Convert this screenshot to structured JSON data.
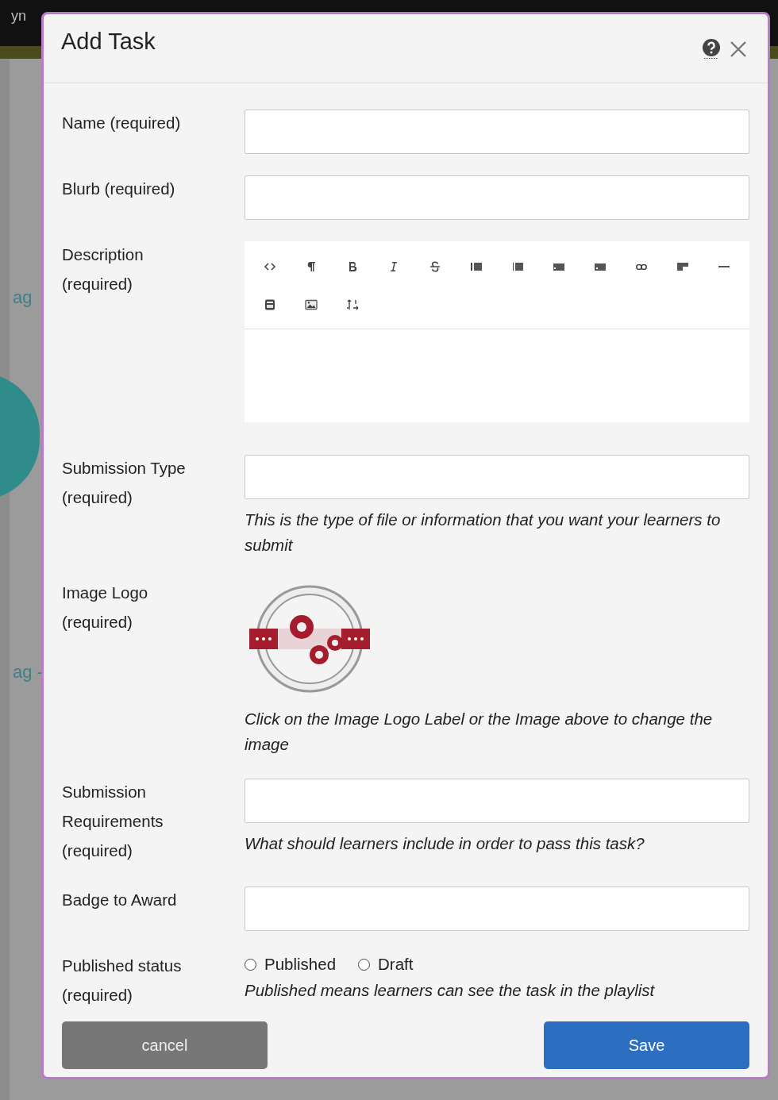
{
  "background": {
    "header_text": "yn",
    "side_links": [
      "ag",
      "ag -"
    ]
  },
  "dialog": {
    "title": "Add Task"
  },
  "fields": [
    {
      "kind": "text",
      "label": "Name (required)"
    },
    {
      "kind": "text",
      "label": "Blurb (required)"
    },
    {
      "kind": "editor",
      "label": "Description (required)"
    },
    {
      "kind": "text",
      "label": "Submission Type (required)",
      "help": "This is the type of file or information that you want your learners to submit"
    },
    {
      "kind": "image",
      "label": "Image Logo (required)",
      "help": "Click on the Image Logo Label or the Image above to change the image"
    },
    {
      "kind": "text",
      "label": "Submission Requirements (required)",
      "help": "What should learners include in order to pass this task?"
    },
    {
      "kind": "text",
      "label": "Badge to Award"
    },
    {
      "kind": "radio",
      "label": "Published status (required)",
      "options": [
        {
          "label": "Published",
          "selected": false
        },
        {
          "label": "Draft",
          "selected": false
        }
      ],
      "help": "Published means learners can see the task in the playlist"
    }
  ],
  "buttons": [
    {
      "kind": "cancel",
      "label": "cancel"
    },
    {
      "kind": "save",
      "label": "Save"
    }
  ]
}
